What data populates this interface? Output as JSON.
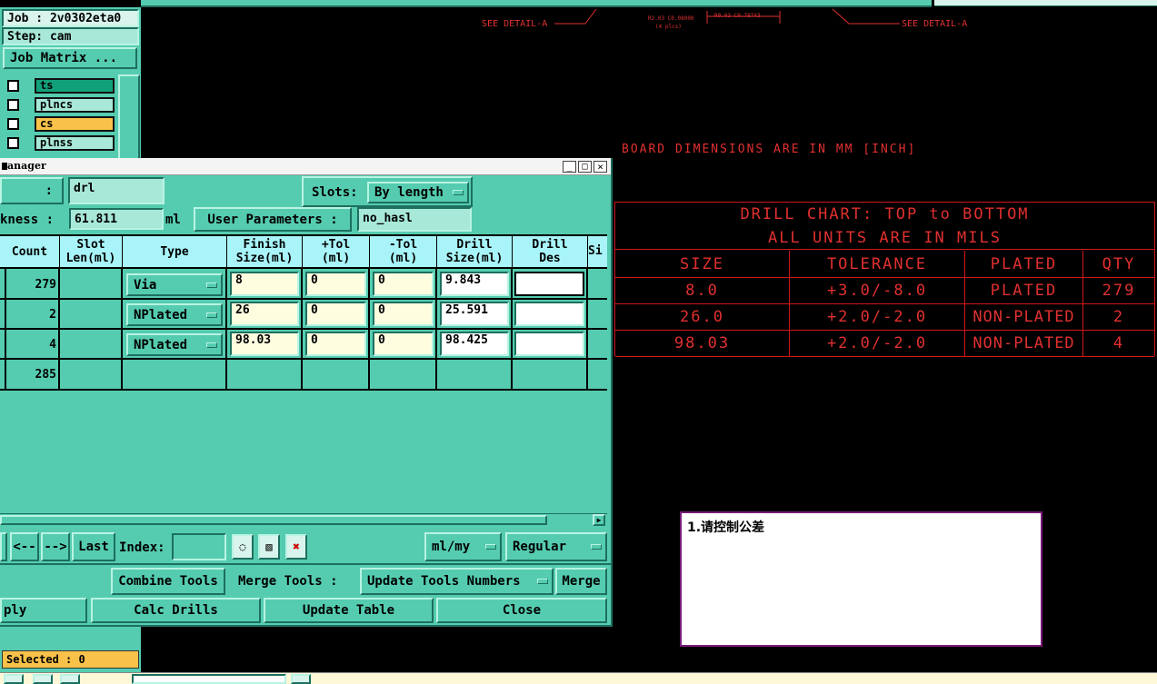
{
  "job_panel": {
    "job": "Job : 2v0302eta0",
    "step": "Step: cam",
    "job_matrix": "Job Matrix ...",
    "layers": [
      {
        "name": "ts",
        "color": "#12a07a"
      },
      {
        "name": "plncs",
        "color": "#a8e8d8"
      },
      {
        "name": "cs",
        "color": "#f8c24a"
      },
      {
        "name": "plnss",
        "color": "#a8e8d8"
      }
    ],
    "selected": "Selected : 0"
  },
  "canvas": {
    "detail_left": "SEE DETAIL-A",
    "detail_right": "SEE DETAIL-A",
    "tiny_note_1": "R2.03 C0.08000",
    "tiny_note_2": "(4 plcs)",
    "tiny_note_3": "R0.03 C0.78743",
    "board_dimensions": "BOARD DIMENSIONS ARE IN MM [INCH]",
    "drill_chart": {
      "title": "DRILL CHART: TOP to BOTTOM",
      "units": "ALL UNITS ARE IN MILS",
      "headers": [
        "SIZE",
        "TOLERANCE",
        "PLATED",
        "QTY"
      ],
      "rows": [
        [
          "8.0",
          "+3.0/-8.0",
          "PLATED",
          "279"
        ],
        [
          "26.0",
          "+2.0/-2.0",
          "NON-PLATED",
          "2"
        ],
        [
          "98.03",
          "+2.0/-2.0",
          "NON-PLATED",
          "4"
        ]
      ]
    },
    "note": "1.请控制公差"
  },
  "dialog": {
    "title": "anager",
    "row1": {
      "colon": ":",
      "layer": "drl",
      "slots_label": "Slots:",
      "slots_value": "By length"
    },
    "row2": {
      "thickness_label": "kness :",
      "thickness_value": "61.811",
      "unit": "ml",
      "user_params_label": "User Parameters :",
      "user_params_value": "no_hasl"
    },
    "table": {
      "headers": [
        "Count",
        "Slot\nLen(ml)",
        "Type",
        "Finish\nSize(ml)",
        "+Tol\n(ml)",
        "-Tol\n(ml)",
        "Drill\nSize(ml)",
        "Drill\nDes",
        "Si"
      ],
      "rows": [
        {
          "count": "279",
          "type": "Via",
          "finish": "8",
          "ptol": "0",
          "mtol": "0",
          "drill": "9.843",
          "des": ""
        },
        {
          "count": "2",
          "type": "NPlated",
          "finish": "26",
          "ptol": "0",
          "mtol": "0",
          "drill": "25.591",
          "des": ""
        },
        {
          "count": "4",
          "type": "NPlated",
          "finish": "98.03",
          "ptol": "0",
          "mtol": "0",
          "drill": "98.425",
          "des": ""
        }
      ],
      "total": "285"
    },
    "nav": {
      "prev": "<--",
      "next": "-->",
      "last": "Last",
      "index_label": "Index:",
      "index_value": "",
      "units": "ml/my",
      "mode": "Regular"
    },
    "tools": {
      "combine": "Combine Tools",
      "merge_label": "Merge Tools :",
      "update_numbers": "Update Tools Numbers",
      "merge": "Merge"
    },
    "actions": {
      "apply": "ply",
      "calc": "Calc Drills",
      "update_table": "Update Table",
      "close": "Close"
    }
  }
}
